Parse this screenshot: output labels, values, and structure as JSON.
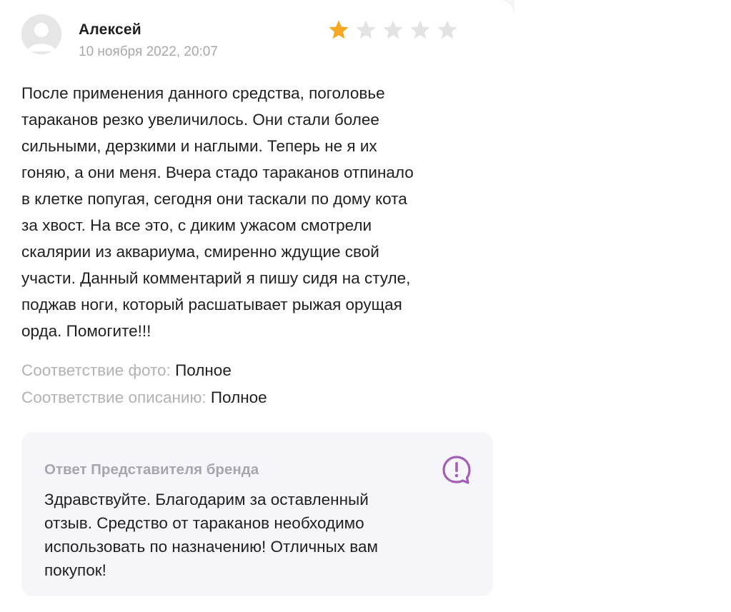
{
  "review": {
    "author": "Алексей",
    "date": "10 ноября 2022, 20:07",
    "rating": 1,
    "rating_max": 5,
    "text": "После применения данного средства, поголовье\nтараканов резко увеличилось. Они стали более\nсильными, дерзкими и наглыми. Теперь не я их\nгоняю, а они меня. Вчера стадо тараканов отпинало\nв клетке попугая, сегодня они таскали по дому кота\nза хвост. На все это, с диким ужасом смотрели\nскалярии из аквариума, смиренно ждущие свой\nучасти. Данный комментарий я пишу сидя на стуле,\nподжав ноги, который расшатывает рыжая орущая\nорда. Помогите!!!"
  },
  "match": {
    "photo_label": "Соответствие фото:",
    "photo_value": "Полное",
    "description_label": "Соответствие описанию:",
    "description_value": "Полное"
  },
  "brand_response": {
    "title": "Ответ Представителя бренда",
    "icon": "alert-chat-icon",
    "text": "Здравствуйте. Благодарим за оставленный\nотзыв. Средство от тараканов необходимо\nиспользовать по назначению! Отличных вам\nпокупок!"
  },
  "colors": {
    "star_filled": "#f5a623",
    "star_empty": "#e3e3e3",
    "accent_purple": "#a35fb5",
    "muted_text": "#b2b2b2",
    "brand_box_bg": "#f6f5fa"
  }
}
